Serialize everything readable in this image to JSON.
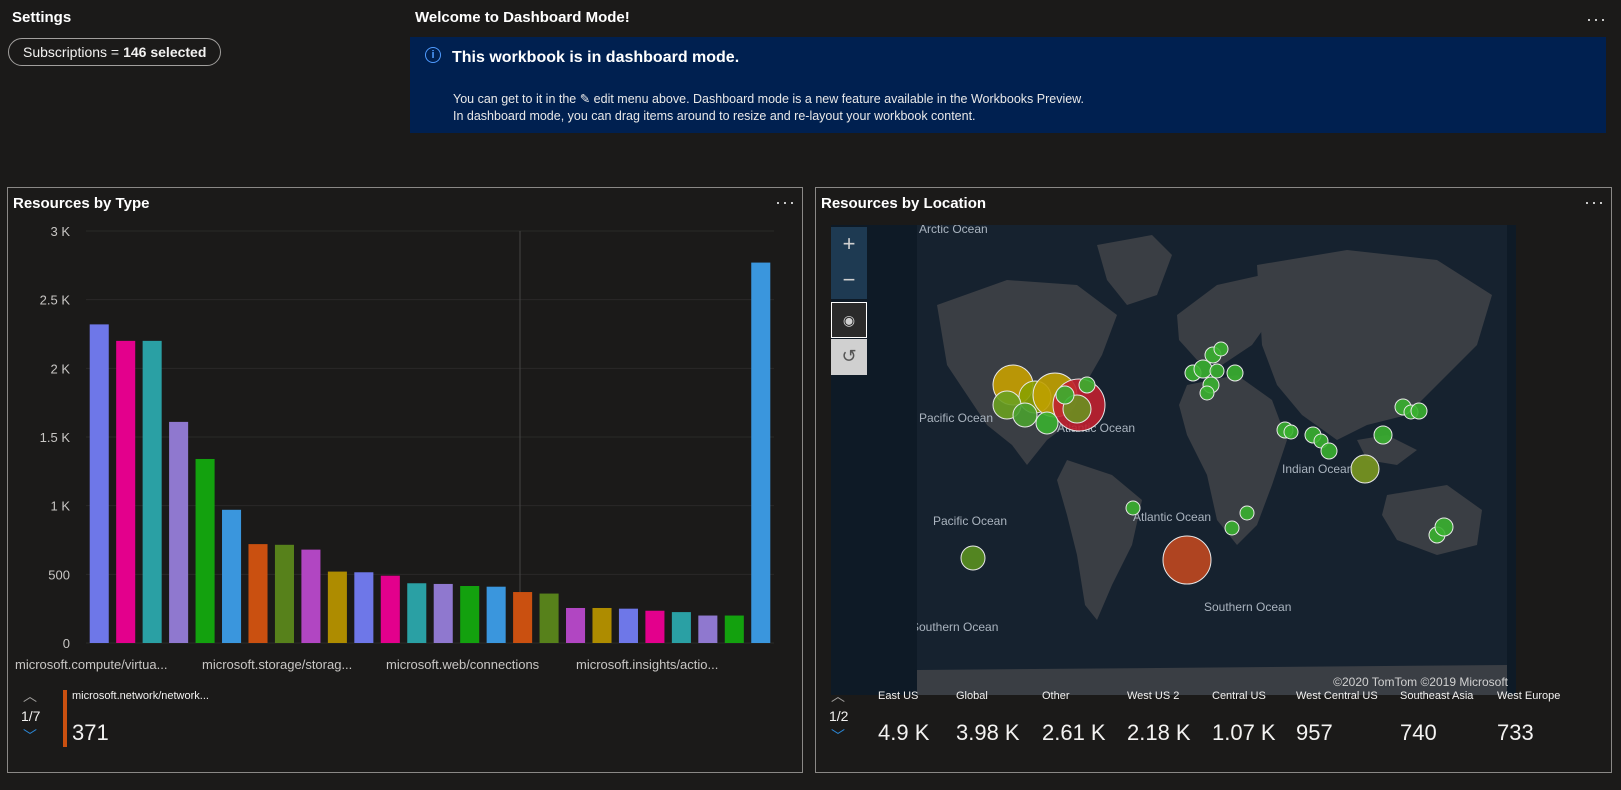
{
  "settings": {
    "title": "Settings",
    "subscriptions_label": "Subscriptions =",
    "subscriptions_value": "146 selected"
  },
  "welcome": {
    "title": "Welcome to Dashboard Mode!",
    "banner_heading": "This workbook is in dashboard mode.",
    "line1": "You can get to it in the ✎ edit menu above. Dashboard mode is a new feature available in the Workbooks Preview.",
    "line2": "In dashboard mode, you can drag items around to resize and re-layout your workbook content.",
    "info_icon": "i"
  },
  "type_panel": {
    "title": "Resources by Type",
    "pager": "1/7",
    "selected_label": "microsoft.network/network...",
    "selected_value": "371",
    "selected_color": "#ca5010"
  },
  "location_panel": {
    "title": "Resources by Location",
    "pager": "1/2",
    "copyright": "©2020 TomTom ©2019 Microsoft",
    "zoom_in": "+",
    "zoom_out": "−",
    "legend": [
      {
        "label": "East US",
        "value": "4.9 K"
      },
      {
        "label": "Global",
        "value": "3.98 K"
      },
      {
        "label": "Other",
        "value": "2.61 K"
      },
      {
        "label": "West US 2",
        "value": "2.18 K"
      },
      {
        "label": "Central US",
        "value": "1.07 K"
      },
      {
        "label": "West Central US",
        "value": "957"
      },
      {
        "label": "Southeast Asia",
        "value": "740"
      },
      {
        "label": "West Europe",
        "value": "733"
      }
    ],
    "ocean_labels": [
      "Arctic Ocean",
      "Pacific Ocean",
      "Atlantic Ocean",
      "Indian Ocean",
      "Pacific Ocean",
      "Atlantic Ocean",
      "Southern Ocean",
      "Southern Ocean"
    ]
  },
  "icons": {
    "more": "more-options-icon",
    "info": "info-icon",
    "chevron_up": "chevron-up-icon",
    "chevron_down": "chevron-down-icon",
    "zoom_in": "zoom-in-icon",
    "zoom_out": "zoom-out-icon",
    "compass": "compass-icon",
    "reset": "reset-view-icon"
  },
  "chart_data": {
    "type": "bar",
    "title": "Resources by Type",
    "ylim": [
      0,
      3000
    ],
    "yticks": [
      "0",
      "500",
      "1 K",
      "1.5 K",
      "2 K",
      "2.5 K",
      "3 K"
    ],
    "xtick_labels": [
      "microsoft.compute/virtua...",
      "microsoft.storage/storag...",
      "microsoft.web/connections",
      "microsoft.insights/actio..."
    ],
    "values": [
      2320,
      2200,
      2200,
      1610,
      1340,
      970,
      720,
      715,
      680,
      520,
      515,
      490,
      435,
      430,
      415,
      410,
      371,
      360,
      255,
      255,
      250,
      235,
      225,
      200,
      200,
      2770
    ],
    "colors": [
      "#6e77e8",
      "#e3008c",
      "#2aa0a4",
      "#8f78cf",
      "#13a10e",
      "#3a96dd",
      "#ca5010",
      "#57811b",
      "#b146c2",
      "#ae8c00",
      "#6e77e8",
      "#e3008c",
      "#2aa0a4",
      "#8f78cf",
      "#13a10e",
      "#3a96dd",
      "#ca5010",
      "#57811b",
      "#b146c2",
      "#ae8c00",
      "#6e77e8",
      "#e3008c",
      "#2aa0a4",
      "#8f78cf",
      "#13a10e",
      "#3a96dd"
    ],
    "legend": "none",
    "grid": true
  }
}
